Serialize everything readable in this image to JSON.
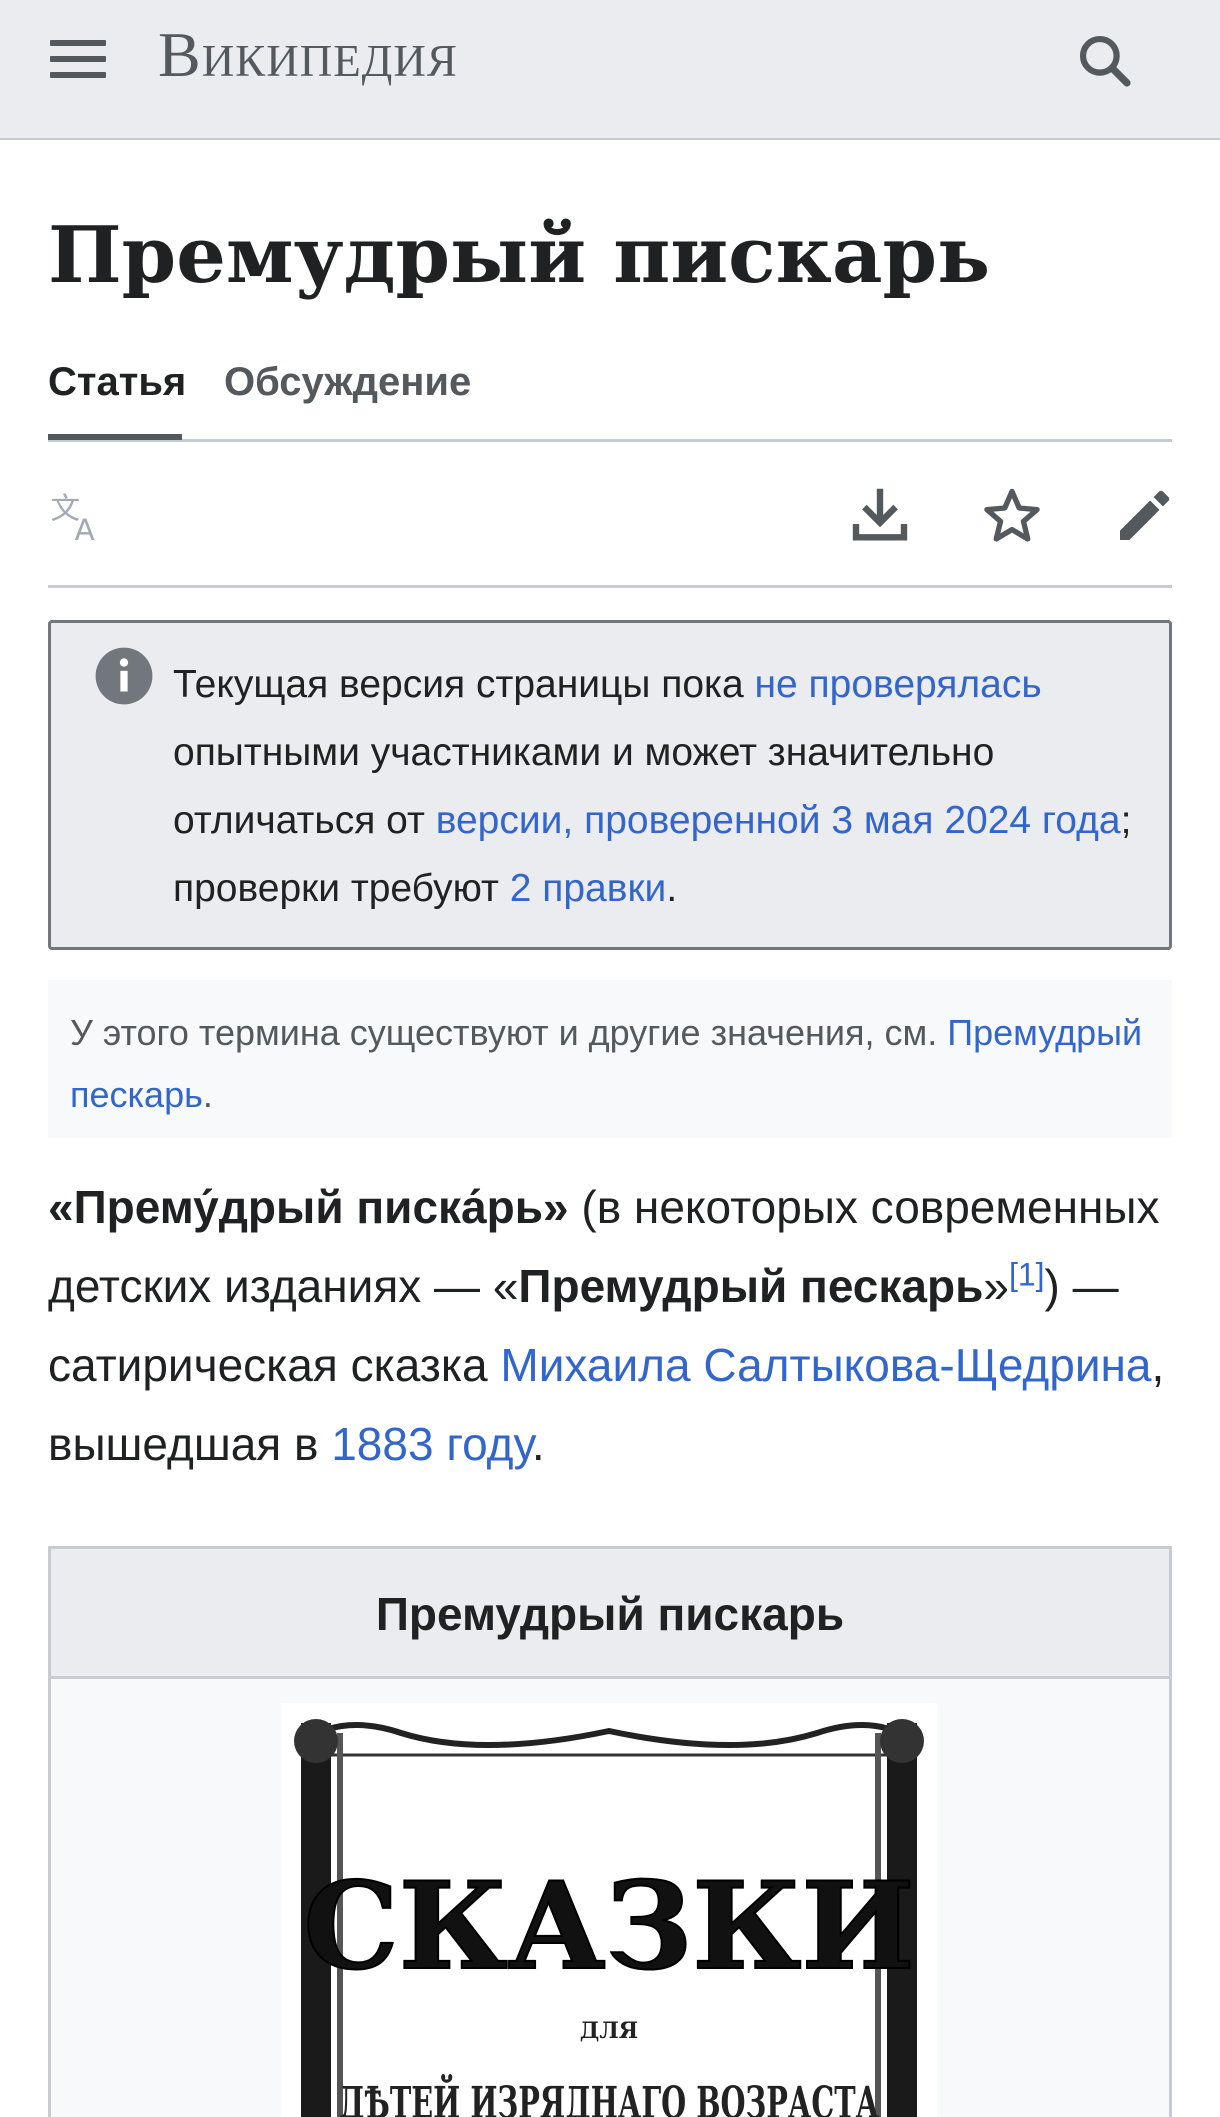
{
  "header": {
    "logo": "Википедия",
    "menu_icon": "hamburger-menu-icon",
    "search_icon": "search-icon"
  },
  "page": {
    "title": "Премудрый пискарь"
  },
  "tabs": [
    {
      "label": "Статья",
      "active": true
    },
    {
      "label": "Обсуждение",
      "active": false
    }
  ],
  "toolbar": {
    "language_icon": "language-icon",
    "download_icon": "download-icon",
    "watch_icon": "star-icon",
    "edit_icon": "pencil-icon"
  },
  "notice": {
    "icon": "info-icon",
    "text_1": "Текущая версия страницы пока ",
    "link_1": "не проверялась",
    "text_2": " опытными участниками и может значительно отличаться от ",
    "link_2": "версии, проверенной 3 мая 2024 года",
    "text_3": "; проверки требуют ",
    "link_3": "2 правки",
    "text_4": "."
  },
  "hatnote": {
    "text": "У этого термина существуют и другие значения, см. ",
    "link": "Премудрый пескарь",
    "end": "."
  },
  "lead": {
    "q_open": "«",
    "bold_1": "Прему́дрый писка́рь",
    "q_close": "»",
    "text_1": " (в некоторых современных детских изданиях — «",
    "bold_2": "Премудрый пескарь",
    "text_2": "»",
    "ref": "[1]",
    "text_3": ") — сатирическая сказка ",
    "link_author": "Михаила Салтыкова-Щедрина",
    "text_4": ", вышедшая в ",
    "link_year": "1883 году",
    "text_5": "."
  },
  "infobox": {
    "title": "Премудрый пискарь",
    "cover_title": "СКАЗКИ",
    "cover_line_small": "ДЛЯ",
    "cover_line": "ДѢТЕЙ ИЗРЯДНАГО ВОЗРАСТА"
  },
  "colors": {
    "link": "#3366cc",
    "header_bg": "#eaecf0",
    "text": "#202122"
  }
}
